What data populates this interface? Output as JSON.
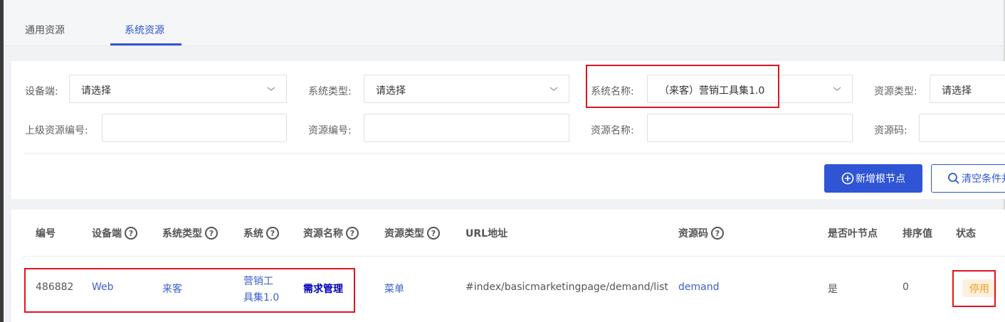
{
  "tabs": [
    {
      "label": "通用资源",
      "active": false
    },
    {
      "label": "系统资源",
      "active": true
    }
  ],
  "filters": {
    "device": {
      "label": "设备端:",
      "value": "请选择"
    },
    "system_type": {
      "label": "系统类型:",
      "value": "请选择"
    },
    "system_name": {
      "label": "系统名称:",
      "value": "（来客）营销工具集1.0"
    },
    "resource_type": {
      "label": "资源类型:",
      "value": "请选择"
    },
    "parent_code": {
      "label": "上级资源编号:",
      "value": ""
    },
    "resource_no": {
      "label": "资源编号:",
      "value": ""
    },
    "resource_name": {
      "label": "资源名称:",
      "value": ""
    },
    "resource_code": {
      "label": "资源码:",
      "value": ""
    }
  },
  "buttons": {
    "add_root": "新增根节点",
    "clear": "清空条件并"
  },
  "table": {
    "columns": [
      "编号",
      "设备端",
      "系统类型",
      "系统",
      "资源名称",
      "资源类型",
      "URL地址",
      "资源码",
      "是否叶节点",
      "排序值",
      "状态"
    ],
    "rows": [
      {
        "id": "486882",
        "device": "Web",
        "system_type": "来客",
        "system_line1": "营销工",
        "system_line2": "具集1.0",
        "resource_name": "需求管理",
        "resource_type": "菜单",
        "url": "#index/basicmarketingpage/demand/list",
        "code": "demand",
        "is_leaf": "是",
        "sort": "0",
        "status": "停用"
      }
    ]
  },
  "colors": {
    "primary": "#2f55d4",
    "highlight": "#e0151f",
    "status_disabled_bg": "#fdf1de",
    "status_disabled_fg": "#f0a020"
  }
}
